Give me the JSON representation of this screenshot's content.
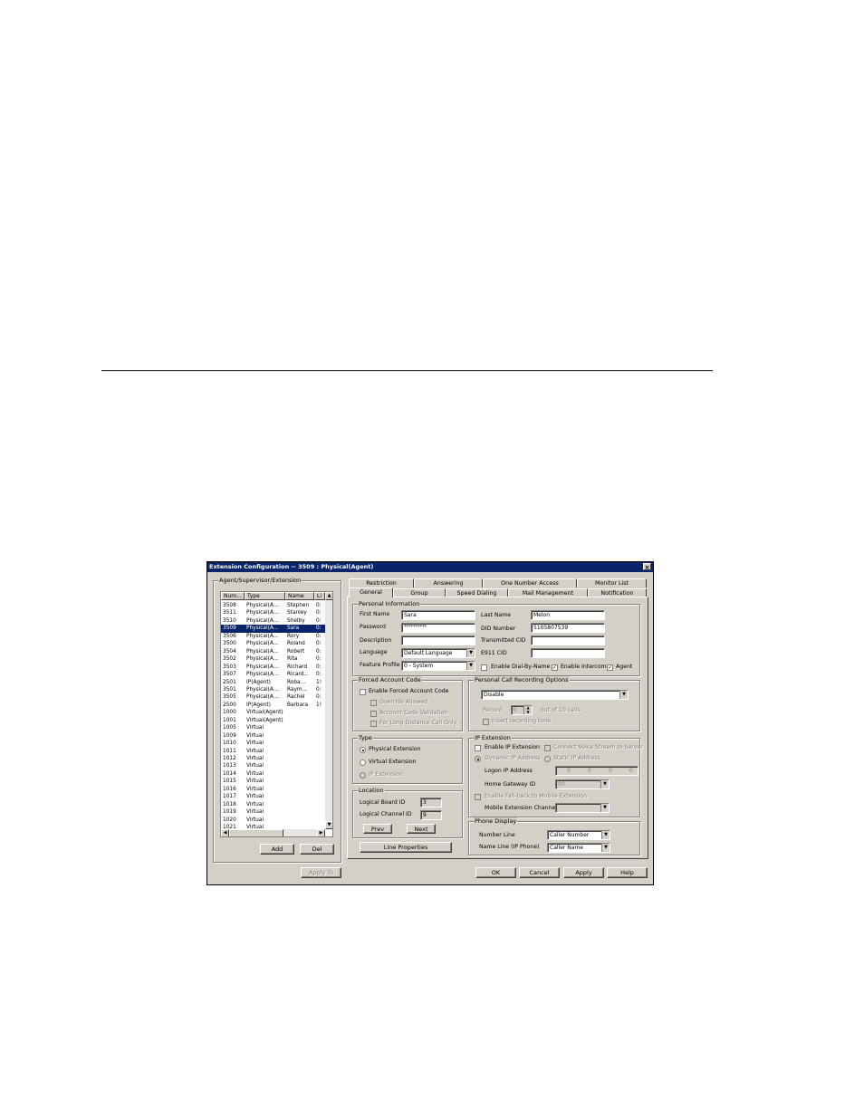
{
  "dialog": {
    "title": "Extension Configuration -- 3509 : Physical(Agent)",
    "close_glyph": "×"
  },
  "left_panel": {
    "group_label": "Agent/Supervisor/Extension",
    "columns": [
      "Num...",
      "Type",
      "Name",
      "Li"
    ],
    "rows": [
      {
        "num": "3508",
        "type": "Physical(A...",
        "name": "Stephen",
        "li": "0:"
      },
      {
        "num": "3511",
        "type": "Physical(A...",
        "name": "Stanley",
        "li": "0:"
      },
      {
        "num": "3510",
        "type": "Physical(A...",
        "name": "Shelby",
        "li": "0:"
      },
      {
        "num": "3509",
        "type": "Physical(A...",
        "name": "Sara",
        "li": "0:"
      },
      {
        "num": "3506",
        "type": "Physical(A...",
        "name": "Rory",
        "li": "0:"
      },
      {
        "num": "3500",
        "type": "Physical(A...",
        "name": "Roland",
        "li": "0:"
      },
      {
        "num": "3504",
        "type": "Physical(A...",
        "name": "Robert",
        "li": "0:"
      },
      {
        "num": "3502",
        "type": "Physical(A...",
        "name": "Rita",
        "li": "0:"
      },
      {
        "num": "3503",
        "type": "Physical(A...",
        "name": "Richard",
        "li": "0:"
      },
      {
        "num": "3507",
        "type": "Physical(A...",
        "name": "Ricard...",
        "li": "0:"
      },
      {
        "num": "2501",
        "type": "IP(Agent)",
        "name": "Roba...",
        "li": "1!"
      },
      {
        "num": "3501",
        "type": "Physical(A...",
        "name": "Raym...",
        "li": "0:"
      },
      {
        "num": "3505",
        "type": "Physical(A...",
        "name": "Rachel",
        "li": "0:"
      },
      {
        "num": "2500",
        "type": "IP(Agent)",
        "name": "Barbara",
        "li": "1!"
      },
      {
        "num": "1000",
        "type": "Virtual(Agent)",
        "name": "",
        "li": ""
      },
      {
        "num": "1001",
        "type": "Virtual(Agent)",
        "name": "",
        "li": ""
      },
      {
        "num": "1005",
        "type": "Virtual",
        "name": "",
        "li": ""
      },
      {
        "num": "1009",
        "type": "Virtual",
        "name": "",
        "li": ""
      },
      {
        "num": "1010",
        "type": "Virtual",
        "name": "",
        "li": ""
      },
      {
        "num": "1011",
        "type": "Virtual",
        "name": "",
        "li": ""
      },
      {
        "num": "1012",
        "type": "Virtual",
        "name": "",
        "li": ""
      },
      {
        "num": "1013",
        "type": "Virtual",
        "name": "",
        "li": ""
      },
      {
        "num": "1014",
        "type": "Virtual",
        "name": "",
        "li": ""
      },
      {
        "num": "1015",
        "type": "Virtual",
        "name": "",
        "li": ""
      },
      {
        "num": "1016",
        "type": "Virtual",
        "name": "",
        "li": ""
      },
      {
        "num": "1017",
        "type": "Virtual",
        "name": "",
        "li": ""
      },
      {
        "num": "1018",
        "type": "Virtual",
        "name": "",
        "li": ""
      },
      {
        "num": "1019",
        "type": "Virtual",
        "name": "",
        "li": ""
      },
      {
        "num": "1020",
        "type": "Virtual",
        "name": "",
        "li": ""
      },
      {
        "num": "1021",
        "type": "Virtual",
        "name": "",
        "li": ""
      }
    ],
    "selected_num": "3509",
    "add_label": "Add",
    "del_label": "Del",
    "apply_to_label": "Apply To"
  },
  "tabs_back": [
    "Restriction",
    "Answering",
    "One Number Access",
    "Monitor List"
  ],
  "tabs_front": [
    "General",
    "Group",
    "Speed Dialing",
    "Mail Management",
    "Notification"
  ],
  "active_tab": "General",
  "personal": {
    "group_label": "Personal Information",
    "first_name_label": "First Name",
    "first_name": "Sara",
    "last_name_label": "Last Name",
    "last_name": "Melon",
    "password_label": "Password",
    "password": "**********",
    "did_label": "DID Number",
    "did": "5105807539",
    "description_label": "Description",
    "description": "",
    "transmitted_cid_label": "Transmitted CID",
    "transmitted_cid": "",
    "language_label": "Language",
    "language": "Default Language",
    "e911_label": "E911 CID",
    "e911": "",
    "feature_profile_label": "Feature Profile",
    "feature_profile": "0 - System",
    "dial_by_name_label": "Enable Dial-By-Name",
    "dial_by_name": false,
    "intercom_label": "Enable Intercom",
    "intercom": true,
    "agent_label": "Agent",
    "agent": true
  },
  "forced_account": {
    "group_label": "Forced Account Code",
    "enable_label": "Enable Forced Account Code",
    "override_label": "Override Allowed",
    "validation_label": "Account Code Validation",
    "long_distance_label": "For Long Distance Call Only"
  },
  "recording": {
    "group_label": "Personal Call Recording Options",
    "mode": "Disable",
    "record_label": "Record",
    "record_value": "0",
    "out_of_label": "out of 10 calls",
    "insert_tone_label": "Insert recording tone"
  },
  "type": {
    "group_label": "Type",
    "physical_label": "Physical Extension",
    "virtual_label": "Virtual Extension",
    "ip_label": "IP Extension",
    "selected": "Physical Extension"
  },
  "ip_extension": {
    "group_label": "IP Extension",
    "enable_label": "Enable IP Extension",
    "connect_label": "Connect Voice Stream to Server",
    "dynamic_label": "Dynamic IP Address",
    "static_label": "Static IP Address",
    "logon_ip_label": "Logon IP Address",
    "logon_ip": [
      "0",
      "0",
      "0",
      "0"
    ],
    "home_gateway_label": "Home Gateway ID",
    "home_gateway": "00",
    "fallback_label": "Enable Fall-back to Mobile Extension",
    "mobile_channel_label": "Mobile Extension Channel",
    "mobile_channel": ""
  },
  "location": {
    "group_label": "Location",
    "board_label": "Logical Board ID",
    "board": "3",
    "channel_label": "Logical Channel ID",
    "channel": "9",
    "prev_label": "Prev",
    "next_label": "Next",
    "line_props_label": "Line Properties"
  },
  "phone_display": {
    "group_label": "Phone Display",
    "number_line_label": "Number Line",
    "number_line": "Caller Number",
    "name_line_label": "Name Line (IP Phone)",
    "name_line": "Caller Name"
  },
  "buttons": {
    "ok": "OK",
    "cancel": "Cancel",
    "apply": "Apply",
    "help": "Help"
  }
}
